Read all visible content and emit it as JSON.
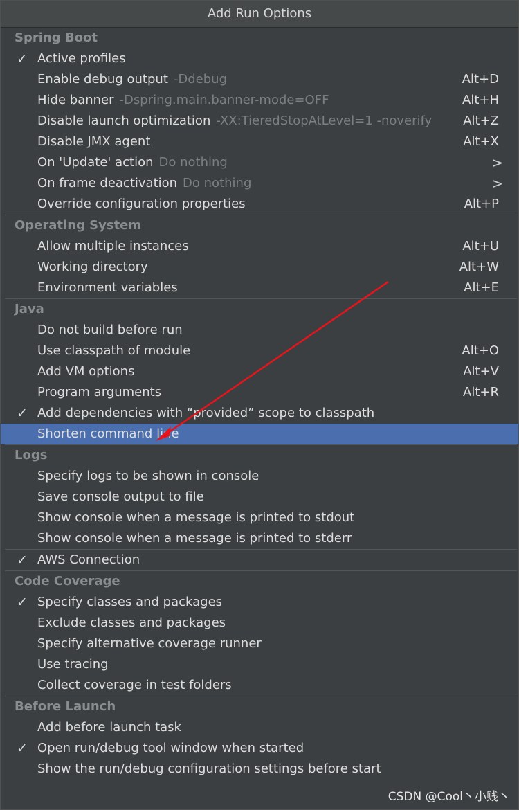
{
  "window": {
    "title": "Add Run Options"
  },
  "icons": {
    "check": "checkmark-icon",
    "submenu": "chevron-right-icon"
  },
  "colors": {
    "background": "#3c3f41",
    "selection": "#4b6eaf",
    "annotation_arrow": "#e8141b"
  },
  "groups": {
    "spring_boot": {
      "header": "Spring Boot",
      "items": [
        {
          "label": "Active profiles",
          "checked": true
        },
        {
          "label": "Enable debug output",
          "hint": "-Ddebug",
          "shortcut": "Alt+D"
        },
        {
          "label": "Hide banner",
          "hint": "-Dspring.main.banner-mode=OFF",
          "shortcut": "Alt+H"
        },
        {
          "label": "Disable launch optimization",
          "hint": "-XX:TieredStopAtLevel=1 -noverify",
          "shortcut": "Alt+Z"
        },
        {
          "label": "Disable JMX agent",
          "shortcut": "Alt+X"
        },
        {
          "label": "On 'Update' action",
          "hint": "Do nothing",
          "submenu": ">"
        },
        {
          "label": "On frame deactivation",
          "hint": "Do nothing",
          "submenu": ">"
        },
        {
          "label": "Override configuration properties",
          "shortcut": "Alt+P"
        }
      ]
    },
    "operating_system": {
      "header": "Operating System",
      "items": [
        {
          "label": "Allow multiple instances",
          "shortcut": "Alt+U"
        },
        {
          "label": "Working directory",
          "shortcut": "Alt+W"
        },
        {
          "label": "Environment variables",
          "shortcut": "Alt+E"
        }
      ]
    },
    "java": {
      "header": "Java",
      "items": [
        {
          "label": "Do not build before run"
        },
        {
          "label": "Use classpath of module",
          "shortcut": "Alt+O"
        },
        {
          "label": "Add VM options",
          "shortcut": "Alt+V"
        },
        {
          "label": "Program arguments",
          "shortcut": "Alt+R"
        },
        {
          "label": "Add dependencies with “provided” scope to classpath",
          "checked": true
        },
        {
          "label": "Shorten command line",
          "selected": true
        }
      ]
    },
    "logs": {
      "header": "Logs",
      "items": [
        {
          "label": "Specify logs to be shown in console"
        },
        {
          "label": "Save console output to file"
        },
        {
          "label": "Show console when a message is printed to stdout"
        },
        {
          "label": "Show console when a message is printed to stderr"
        }
      ]
    },
    "aws": {
      "items": [
        {
          "label": "AWS Connection",
          "checked": true
        }
      ]
    },
    "code_coverage": {
      "header": "Code Coverage",
      "items": [
        {
          "label": "Specify classes and packages",
          "checked": true
        },
        {
          "label": "Exclude classes and packages"
        },
        {
          "label": "Specify alternative coverage runner"
        },
        {
          "label": "Use tracing"
        },
        {
          "label": "Collect coverage in test folders"
        }
      ]
    },
    "before_launch": {
      "header": "Before Launch",
      "items": [
        {
          "label": "Add before launch task"
        },
        {
          "label": "Open run/debug tool window when started",
          "checked": true
        },
        {
          "label": "Show the run/debug configuration settings before start"
        }
      ]
    }
  },
  "watermark": "CSDN @Cool丶小贱丶"
}
